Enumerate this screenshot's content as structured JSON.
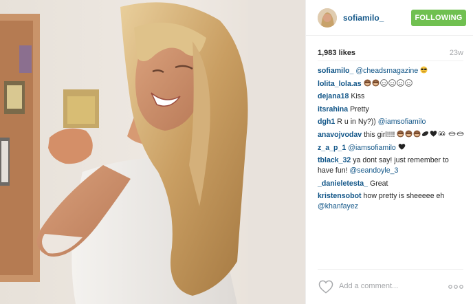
{
  "post": {
    "username": "sofiamilo_",
    "follow_label": "FOLLOWING",
    "likes": "1,983 likes",
    "age": "23w",
    "add_comment_placeholder": "Add a comment...",
    "colors": {
      "link": "#125688",
      "follow": "#70c050",
      "muted": "#a5a7aa"
    }
  },
  "comments": [
    {
      "user": "sofiamilo_",
      "mention": "@cheadsmagazine",
      "text": "",
      "emoji": [
        "sunglasses-emoji"
      ]
    },
    {
      "user": "lolita_lola.as",
      "mention": "",
      "text": "",
      "emoji": [
        "monkey-emoji",
        "monkey-emoji",
        "smile-emoji",
        "smile-emoji",
        "smile-emoji",
        "smile-emoji"
      ]
    },
    {
      "user": "dejana18",
      "mention": "",
      "text": "Kiss",
      "emoji": []
    },
    {
      "user": "itsrahina",
      "mention": "",
      "text": "Pretty",
      "emoji": []
    },
    {
      "user": "dgh1",
      "mention": "@iamsofiamilo",
      "text": "R u in Ny?))",
      "emoji": []
    },
    {
      "user": "anavojvodav",
      "mention": "",
      "text": "this girl!!!!",
      "emoji": [
        "monkey-emoji",
        "monkey-emoji",
        "monkey-emoji",
        "kiss-emoji",
        "heart-emoji",
        "eyes-emoji"
      ],
      "trailing_emoji": [
        "lips-emoji",
        "lips-emoji"
      ]
    },
    {
      "user": "z_a_p_1",
      "mention": "@iamsofiamilo",
      "text": "",
      "emoji": [
        "heart-emoji"
      ]
    },
    {
      "user": "tblack_32",
      "mention": "@seandoyle_3",
      "text": "ya dont say! just remember to have fun!",
      "emoji": []
    },
    {
      "user": "_danieletesta_",
      "mention": "",
      "text": "Great",
      "emoji": []
    },
    {
      "user": "kristensobot",
      "mention": "@khanfayez",
      "text": "how pretty is sheeeee eh",
      "emoji": []
    }
  ]
}
